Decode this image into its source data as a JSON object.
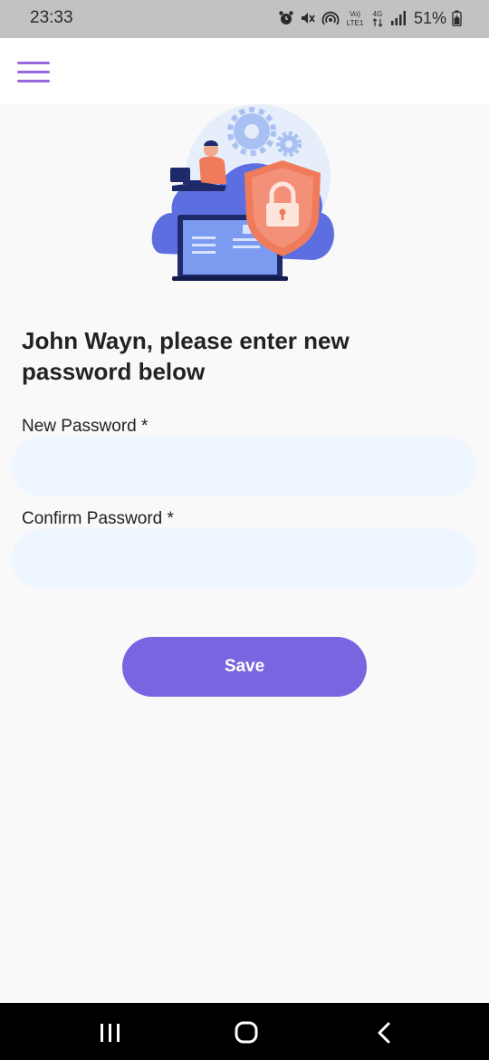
{
  "status_bar": {
    "time": "23:33",
    "network_top": "Vo)",
    "network_bottom": "LTE1",
    "network_gen": "4G",
    "battery": "51%",
    "icons": [
      "alarm-icon",
      "mute-icon",
      "hotspot-icon",
      "volte-icon",
      "4g-icon",
      "signal-icon",
      "battery-icon"
    ]
  },
  "header": {
    "menu_icon": "hamburger-menu-icon",
    "accent_color": "#9a66e0"
  },
  "hero": {
    "illustration": "cloud-security-illustration",
    "icons": [
      "gear-icon",
      "shield-lock-icon",
      "laptop-icon",
      "person-icon"
    ]
  },
  "form": {
    "heading": "John Wayn, please enter new password below",
    "new_password": {
      "label": "New Password *",
      "value": "",
      "placeholder": ""
    },
    "confirm_password": {
      "label": "Confirm Password *",
      "value": "",
      "placeholder": ""
    },
    "save_label": "Save",
    "input_bg": "#eef6ff",
    "button_color": "#7b64e0"
  },
  "nav_bar": {
    "icons": [
      "recent-apps-icon",
      "home-icon",
      "back-icon"
    ]
  }
}
